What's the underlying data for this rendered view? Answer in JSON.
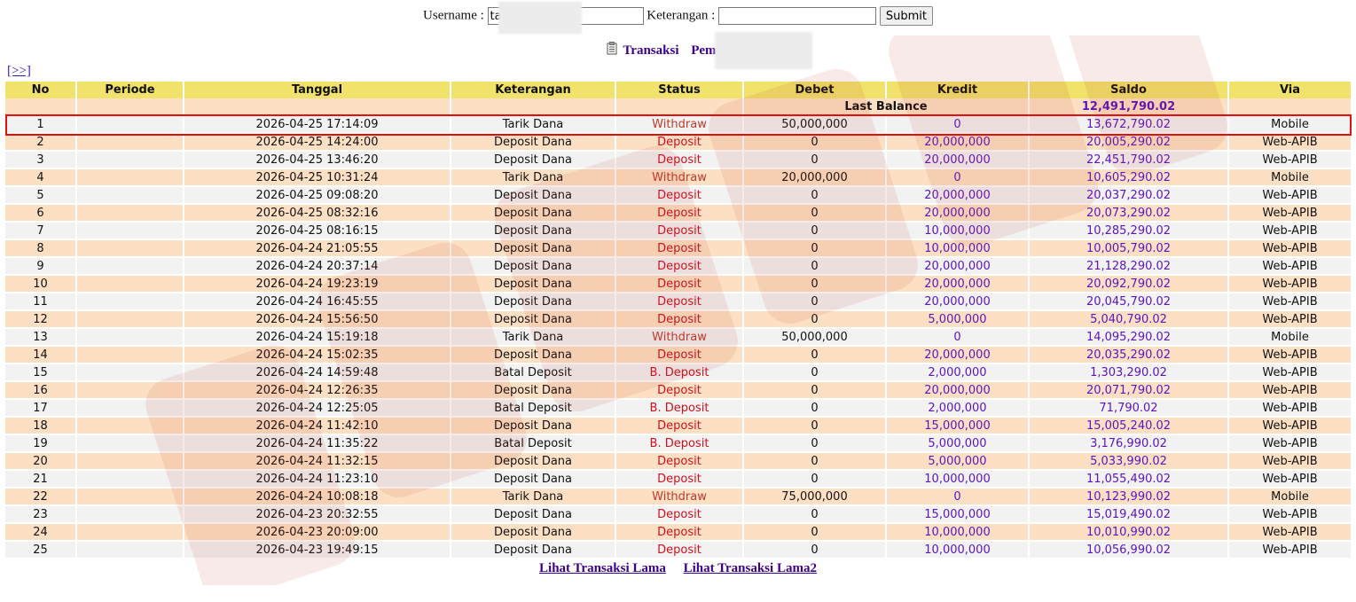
{
  "search": {
    "username_label": "Username :",
    "username_value": "ta",
    "keterangan_label": "Keterangan :",
    "keterangan_value": "",
    "submit_label": "Submit"
  },
  "heading": {
    "title": "Transaksi",
    "pemain_label": "Pemain : t"
  },
  "nav_next": "[>>]",
  "columns": [
    "No",
    "Periode",
    "Tanggal",
    "Keterangan",
    "Status",
    "Debet",
    "Kredit",
    "Saldo",
    "Via"
  ],
  "last_balance": {
    "label": "Last Balance",
    "saldo": "12,491,790.02"
  },
  "rows": [
    {
      "no": "1",
      "periode": "",
      "tanggal": "2026-04-25 17:14:09",
      "keterangan": "Tarik Dana",
      "status": "Withdraw",
      "debet": "50,000,000",
      "kredit": "0",
      "saldo": "13,672,790.02",
      "via": "Mobile"
    },
    {
      "no": "2",
      "periode": "",
      "tanggal": "2026-04-25 14:24:00",
      "keterangan": "Deposit Dana",
      "status": "Deposit",
      "debet": "0",
      "kredit": "20,000,000",
      "saldo": "20,005,290.02",
      "via": "Web-APIB"
    },
    {
      "no": "3",
      "periode": "",
      "tanggal": "2026-04-25 13:46:20",
      "keterangan": "Deposit Dana",
      "status": "Deposit",
      "debet": "0",
      "kredit": "20,000,000",
      "saldo": "22,451,790.02",
      "via": "Web-APIB"
    },
    {
      "no": "4",
      "periode": "",
      "tanggal": "2026-04-25 10:31:24",
      "keterangan": "Tarik Dana",
      "status": "Withdraw",
      "debet": "20,000,000",
      "kredit": "0",
      "saldo": "10,605,290.02",
      "via": "Mobile"
    },
    {
      "no": "5",
      "periode": "",
      "tanggal": "2026-04-25 09:08:20",
      "keterangan": "Deposit Dana",
      "status": "Deposit",
      "debet": "0",
      "kredit": "20,000,000",
      "saldo": "20,037,290.02",
      "via": "Web-APIB"
    },
    {
      "no": "6",
      "periode": "",
      "tanggal": "2026-04-25 08:32:16",
      "keterangan": "Deposit Dana",
      "status": "Deposit",
      "debet": "0",
      "kredit": "20,000,000",
      "saldo": "20,073,290.02",
      "via": "Web-APIB"
    },
    {
      "no": "7",
      "periode": "",
      "tanggal": "2026-04-25 08:16:15",
      "keterangan": "Deposit Dana",
      "status": "Deposit",
      "debet": "0",
      "kredit": "10,000,000",
      "saldo": "10,285,290.02",
      "via": "Web-APIB"
    },
    {
      "no": "8",
      "periode": "",
      "tanggal": "2026-04-24 21:05:55",
      "keterangan": "Deposit Dana",
      "status": "Deposit",
      "debet": "0",
      "kredit": "10,000,000",
      "saldo": "10,005,790.02",
      "via": "Web-APIB"
    },
    {
      "no": "9",
      "periode": "",
      "tanggal": "2026-04-24 20:37:14",
      "keterangan": "Deposit Dana",
      "status": "Deposit",
      "debet": "0",
      "kredit": "20,000,000",
      "saldo": "21,128,290.02",
      "via": "Web-APIB"
    },
    {
      "no": "10",
      "periode": "",
      "tanggal": "2026-04-24 19:23:19",
      "keterangan": "Deposit Dana",
      "status": "Deposit",
      "debet": "0",
      "kredit": "20,000,000",
      "saldo": "20,092,790.02",
      "via": "Web-APIB"
    },
    {
      "no": "11",
      "periode": "",
      "tanggal": "2026-04-24 16:45:55",
      "keterangan": "Deposit Dana",
      "status": "Deposit",
      "debet": "0",
      "kredit": "20,000,000",
      "saldo": "20,045,790.02",
      "via": "Web-APIB"
    },
    {
      "no": "12",
      "periode": "",
      "tanggal": "2026-04-24 15:56:50",
      "keterangan": "Deposit Dana",
      "status": "Deposit",
      "debet": "0",
      "kredit": "5,000,000",
      "saldo": "5,040,790.02",
      "via": "Web-APIB"
    },
    {
      "no": "13",
      "periode": "",
      "tanggal": "2026-04-24 15:19:18",
      "keterangan": "Tarik Dana",
      "status": "Withdraw",
      "debet": "50,000,000",
      "kredit": "0",
      "saldo": "14,095,290.02",
      "via": "Mobile"
    },
    {
      "no": "14",
      "periode": "",
      "tanggal": "2026-04-24 15:02:35",
      "keterangan": "Deposit Dana",
      "status": "Deposit",
      "debet": "0",
      "kredit": "20,000,000",
      "saldo": "20,035,290.02",
      "via": "Web-APIB"
    },
    {
      "no": "15",
      "periode": "",
      "tanggal": "2026-04-24 14:59:48",
      "keterangan": "Batal Deposit",
      "status": "B. Deposit",
      "debet": "0",
      "kredit": "2,000,000",
      "saldo": "1,303,290.02",
      "via": "Web-APIB"
    },
    {
      "no": "16",
      "periode": "",
      "tanggal": "2026-04-24 12:26:35",
      "keterangan": "Deposit Dana",
      "status": "Deposit",
      "debet": "0",
      "kredit": "20,000,000",
      "saldo": "20,071,790.02",
      "via": "Web-APIB"
    },
    {
      "no": "17",
      "periode": "",
      "tanggal": "2026-04-24 12:25:05",
      "keterangan": "Batal Deposit",
      "status": "B. Deposit",
      "debet": "0",
      "kredit": "2,000,000",
      "saldo": "71,790.02",
      "via": "Web-APIB"
    },
    {
      "no": "18",
      "periode": "",
      "tanggal": "2026-04-24 11:42:10",
      "keterangan": "Deposit Dana",
      "status": "Deposit",
      "debet": "0",
      "kredit": "15,000,000",
      "saldo": "15,005,240.02",
      "via": "Web-APIB"
    },
    {
      "no": "19",
      "periode": "",
      "tanggal": "2026-04-24 11:35:22",
      "keterangan": "Batal Deposit",
      "status": "B. Deposit",
      "debet": "0",
      "kredit": "5,000,000",
      "saldo": "3,176,990.02",
      "via": "Web-APIB"
    },
    {
      "no": "20",
      "periode": "",
      "tanggal": "2026-04-24 11:32:15",
      "keterangan": "Deposit Dana",
      "status": "Deposit",
      "debet": "0",
      "kredit": "5,000,000",
      "saldo": "5,033,990.02",
      "via": "Web-APIB"
    },
    {
      "no": "21",
      "periode": "",
      "tanggal": "2026-04-24 11:23:10",
      "keterangan": "Deposit Dana",
      "status": "Deposit",
      "debet": "0",
      "kredit": "10,000,000",
      "saldo": "11,055,490.02",
      "via": "Web-APIB"
    },
    {
      "no": "22",
      "periode": "",
      "tanggal": "2026-04-24 10:08:18",
      "keterangan": "Tarik Dana",
      "status": "Withdraw",
      "debet": "75,000,000",
      "kredit": "0",
      "saldo": "10,123,990.02",
      "via": "Mobile"
    },
    {
      "no": "23",
      "periode": "",
      "tanggal": "2026-04-23 20:32:55",
      "keterangan": "Deposit Dana",
      "status": "Deposit",
      "debet": "0",
      "kredit": "15,000,000",
      "saldo": "15,019,490.02",
      "via": "Web-APIB"
    },
    {
      "no": "24",
      "periode": "",
      "tanggal": "2026-04-23 20:09:00",
      "keterangan": "Deposit Dana",
      "status": "Deposit",
      "debet": "0",
      "kredit": "10,000,000",
      "saldo": "10,010,990.02",
      "via": "Web-APIB"
    },
    {
      "no": "25",
      "periode": "",
      "tanggal": "2026-04-23 19:49:15",
      "keterangan": "Deposit Dana",
      "status": "Deposit",
      "debet": "0",
      "kredit": "10,000,000",
      "saldo": "10,056,990.02",
      "via": "Web-APIB"
    }
  ],
  "footer": {
    "link1": "Lihat Transaksi Lama",
    "link2": "Lihat Transaksi Lama2"
  },
  "colors": {
    "header_bg": "#f0e26a",
    "row_odd": "#f2f2f2",
    "row_even": "#fde0c3",
    "highlight": "#e01010",
    "accent_purple": "#5a14c0",
    "status_red": "#d0101f"
  }
}
